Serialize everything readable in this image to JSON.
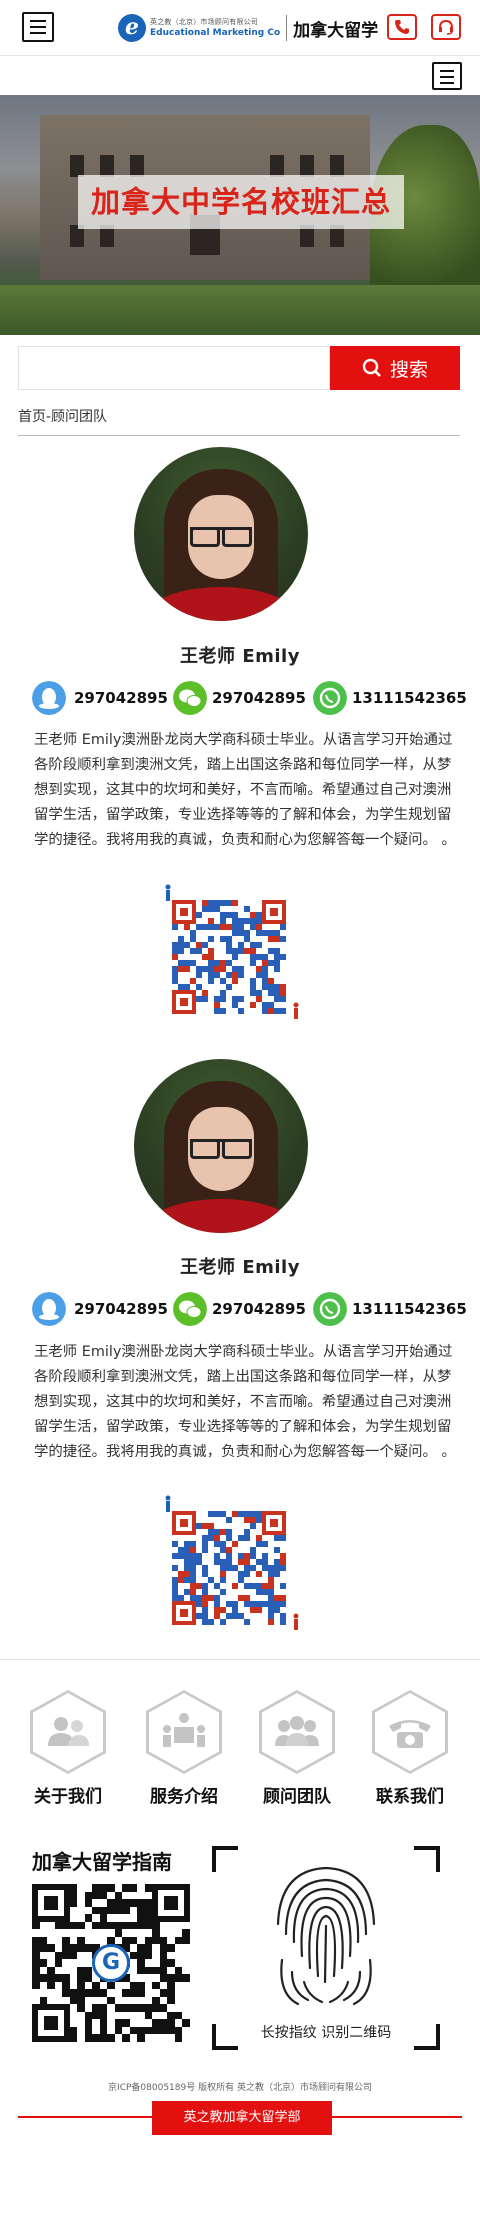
{
  "header": {
    "logo_small": "英之教（北京）市场顾问有限公司",
    "logo_en": "Educational Marketing Co",
    "logo_cn": "加拿大留学",
    "logo_letter": "e",
    "phone_icon": "phone-icon",
    "service_icon": "headset-icon"
  },
  "banner": {
    "title": "加拿大中学名校班汇总"
  },
  "search": {
    "placeholder": "",
    "button_label": "搜索"
  },
  "breadcrumb": "首页-顾问团队",
  "advisors": [
    {
      "name": "王老师 Emily",
      "qq": "297042895",
      "wechat": "297042895",
      "phone": "13111542365",
      "bio": "王老师 Emily澳洲卧龙岗大学商科硕士毕业。从语言学习开始通过各阶段顺利拿到澳洲文凭，踏上出国这条路和每位同学一样，从梦想到实现，这其中的坎坷和美好，不言而喻。希望通过自己对澳洲留学生活，留学政策，专业选择等等的了解和体会，为学生规划留学的捷径。我将用我的真诚，负责和耐心为您解答每一个疑问。 。"
    },
    {
      "name": "王老师 Emily",
      "qq": "297042895",
      "wechat": "297042895",
      "phone": "13111542365",
      "bio": "王老师 Emily澳洲卧龙岗大学商科硕士毕业。从语言学习开始通过各阶段顺利拿到澳洲文凭，踏上出国这条路和每位同学一样，从梦想到实现，这其中的坎坷和美好，不言而喻。希望通过自己对澳洲留学生活，留学政策，专业选择等等的了解和体会，为学生规划留学的捷径。我将用我的真诚，负责和耐心为您解答每一个疑问。 。"
    }
  ],
  "footer_nav": [
    {
      "label": "关于我们",
      "icon": "people-icon"
    },
    {
      "label": "服务介绍",
      "icon": "meeting-icon"
    },
    {
      "label": "顾问团队",
      "icon": "team-icon"
    },
    {
      "label": "联系我们",
      "icon": "telephone-icon"
    }
  ],
  "guide": {
    "title": "加拿大留学指南",
    "scan_label": "长按指纹 识别二维码",
    "qr_center": "G"
  },
  "footer": {
    "icp": "京ICP备08005189号 版权所有 英之教（北京）市场顾问有限公司",
    "button_label": "英之教加拿大留学部"
  },
  "colors": {
    "brand_red": "#e2110f",
    "qq_blue": "#4a9fe6",
    "wechat_green": "#5cbf2a",
    "whatsapp_green": "#4cc04a"
  }
}
